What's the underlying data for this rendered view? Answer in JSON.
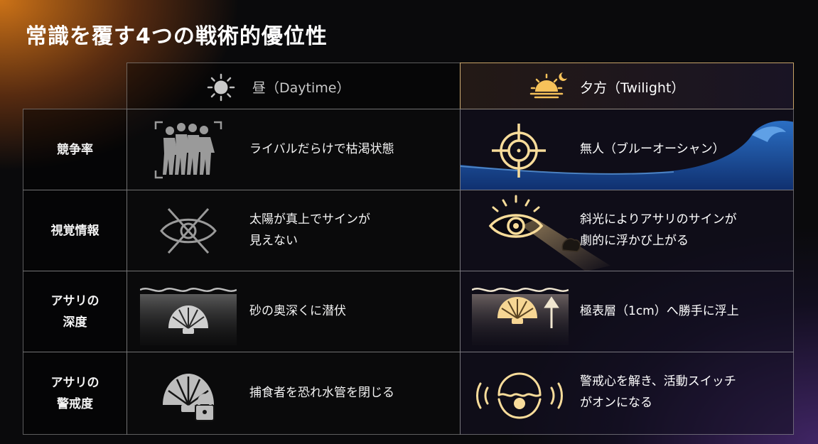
{
  "title": "常識を覆す4つの戦術的優位性",
  "columns": {
    "day": "昼（Daytime）",
    "twilight": "夕方（Twilight）"
  },
  "rows": [
    {
      "label": [
        "競争率",
        ""
      ],
      "day": [
        "ライバルだらけで枯渇状態",
        ""
      ],
      "day_icon": "crowd-icon",
      "twilight": [
        "無人（ブルーオーシャン）",
        ""
      ],
      "twilight_icon": "crosshair-wave-icon"
    },
    {
      "label": [
        "視覚情報",
        ""
      ],
      "day": [
        "太陽が真上でサインが",
        "見えない"
      ],
      "day_icon": "eye-crossed-icon",
      "twilight": [
        "斜光によりアサリのサインが",
        "劇的に浮かび上がる"
      ],
      "twilight_icon": "eye-light-beam-icon"
    },
    {
      "label": [
        "アサリの",
        "深度"
      ],
      "day": [
        "砂の奥深くに潜伏",
        ""
      ],
      "day_icon": "shell-buried-icon",
      "twilight": [
        "極表層（1cm）へ勝手に浮上",
        ""
      ],
      "twilight_icon": "shell-rising-icon"
    },
    {
      "label": [
        "アサリの",
        "警戒度"
      ],
      "day": [
        "捕食者を恐れ水管を閉じる",
        ""
      ],
      "day_icon": "shell-lock-icon",
      "twilight": [
        "警戒心を解き、活動スイッチ",
        "がオンになる"
      ],
      "twilight_icon": "shell-open-pearl-icon"
    }
  ],
  "colors": {
    "accent": "#f4c86a",
    "wave": "#1f5aa8"
  }
}
